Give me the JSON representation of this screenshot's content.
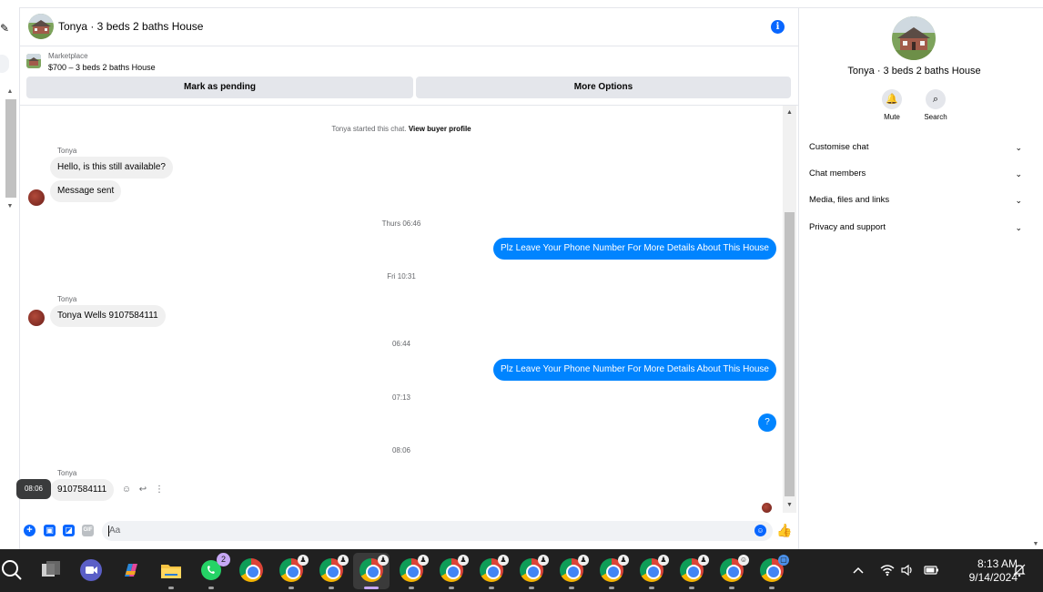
{
  "header": {
    "title": "Tonya · 3 beds 2 baths House",
    "info_icon": "i"
  },
  "marketplace": {
    "label": "Marketplace",
    "price_line": "$700 – 3 beds 2 baths House"
  },
  "actions": {
    "mark_pending": "Mark as pending",
    "more_options": "More Options"
  },
  "messages": {
    "started_text": "Tonya started this chat.",
    "view_profile": "View buyer profile",
    "sender_name": "Tonya",
    "in_1": "Hello, is this still available?",
    "in_2": "Message sent",
    "time_1": "Thurs 06:46",
    "out_1": "Plz Leave Your Phone Number For More Details About This House",
    "time_2": "Fri 10:31",
    "in_3": "Tonya Wells 9107584111",
    "time_3": "06:44",
    "out_2": "Plz Leave Your Phone Number For More Details About This House",
    "time_4": "07:13",
    "out_3": "?",
    "time_5": "08:06",
    "in_4": "9107584111",
    "tooltip": "08:06"
  },
  "composer": {
    "placeholder": "Aa",
    "gif_label": "GIF"
  },
  "right_panel": {
    "title": "Tonya · 3 beds 2 baths House",
    "mute": "Mute",
    "search": "Search",
    "sections": [
      "Customise chat",
      "Chat members",
      "Media, files and links",
      "Privacy and support"
    ]
  },
  "taskbar": {
    "whatsapp_badge": "2",
    "time": "8:13 AM",
    "date": "9/14/2024"
  },
  "colors": {
    "accent": "#0866ff",
    "outgoing_bubble": "#0084ff",
    "incoming_bubble": "#f0f0f0",
    "taskbar": "#202020"
  }
}
